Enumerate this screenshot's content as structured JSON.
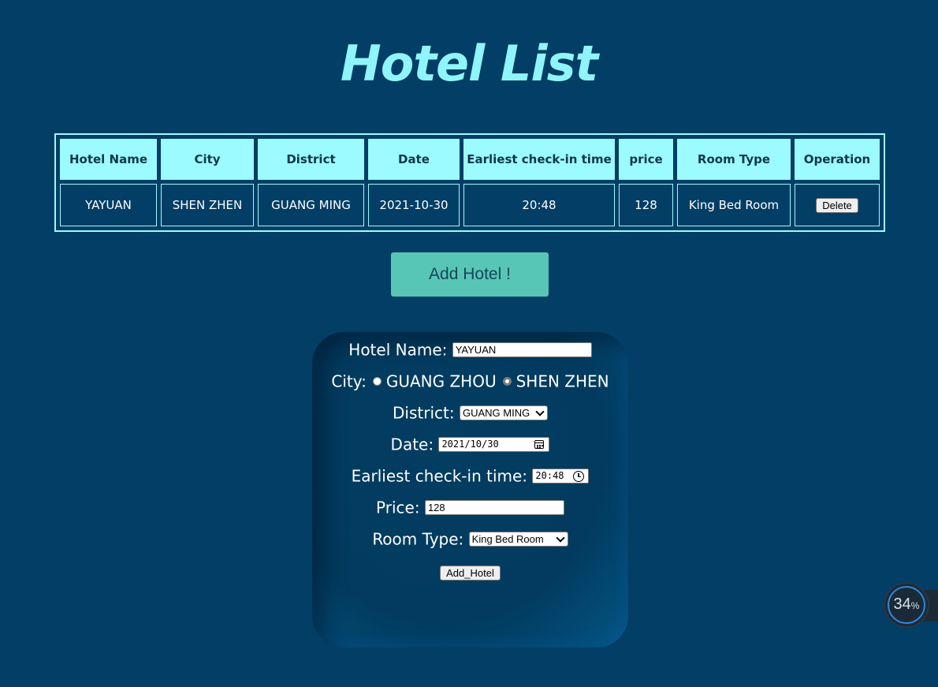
{
  "page": {
    "title": "Hotel List"
  },
  "table": {
    "headers": [
      "Hotel Name",
      "City",
      "District",
      "Date",
      "Earliest check-in time",
      "price",
      "Room Type",
      "Operation"
    ],
    "rows": [
      {
        "hotel_name": "YAYUAN",
        "city": "SHEN ZHEN",
        "district": "GUANG MING",
        "date": "2021-10-30",
        "checkin": "20:48",
        "price": "128",
        "room_type": "King Bed Room",
        "delete_label": "Delete"
      }
    ]
  },
  "add_button": {
    "label": "Add Hotel !"
  },
  "form": {
    "hotel_name": {
      "label": "Hotel Name:",
      "value": "YAYUAN"
    },
    "city": {
      "label": "City:",
      "options": [
        "GUANG ZHOU",
        "SHEN ZHEN"
      ],
      "selected": "SHEN ZHEN"
    },
    "district": {
      "label": "District:",
      "value": "GUANG MING"
    },
    "date": {
      "label": "Date:",
      "value": "2021/10/30"
    },
    "checkin": {
      "label": "Earliest check-in time:",
      "value": "20:48"
    },
    "price": {
      "label": "Price:",
      "value": "128"
    },
    "room_type": {
      "label": "Room Type:",
      "value": "King Bed Room"
    },
    "submit_label": "Add_Hotel"
  },
  "overlay": {
    "progress_value": "34",
    "progress_unit": "%"
  },
  "colors": {
    "background": "#023e65",
    "title": "#8ff5fb",
    "table_border": "#9cfbff",
    "header_bg": "#9cfbff",
    "add_button_bg": "#58c6b6"
  }
}
